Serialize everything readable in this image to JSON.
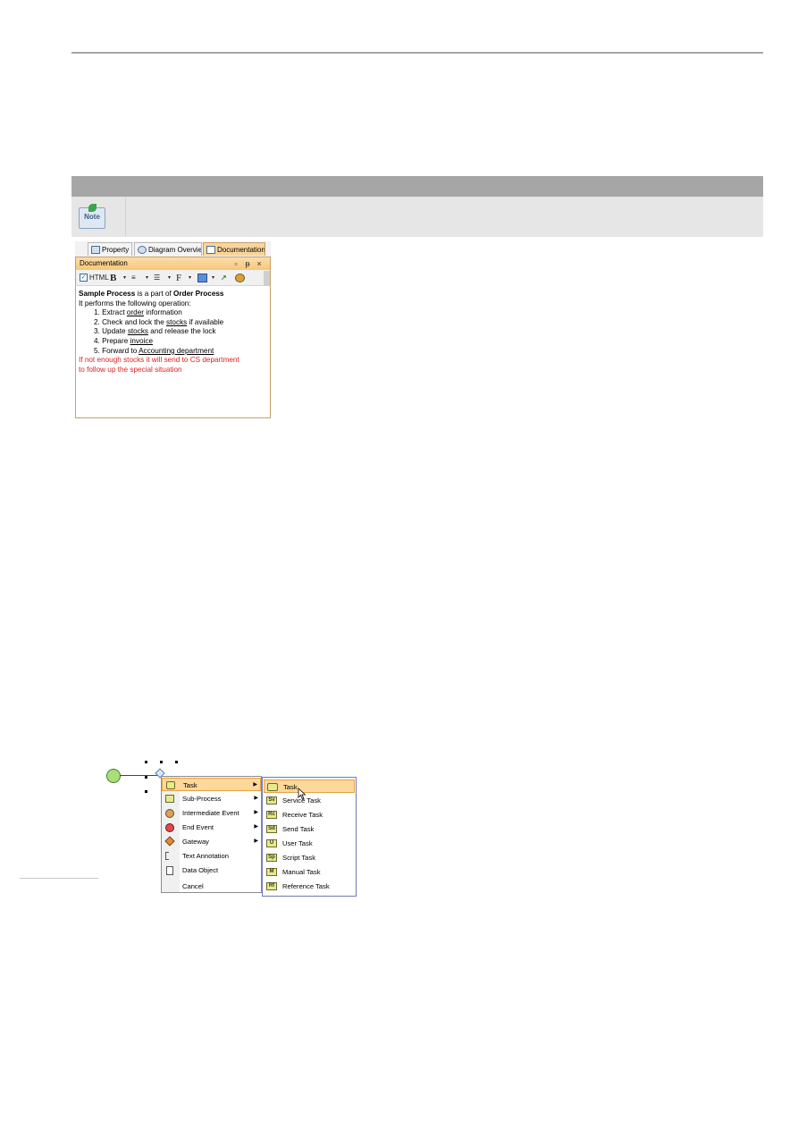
{
  "note": {
    "icon_label": "Note"
  },
  "panel": {
    "tabs": [
      "Property",
      "Diagram Overview",
      "Documentation"
    ],
    "title": "Documentation",
    "toolbar": {
      "html_label": "HTML",
      "bold_label": "B",
      "font_label": "F"
    },
    "content": {
      "line1": {
        "b1": "Sample Process",
        "mid": " is a part of ",
        "b2": "Order Process"
      },
      "line2": "It performs the following operation:",
      "steps": [
        {
          "num": "1.",
          "pre": "Extract ",
          "u": "order",
          "post": " information"
        },
        {
          "num": "2.",
          "pre": "Check and lock the ",
          "u": "stocks",
          "post": " if available"
        },
        {
          "num": "3.",
          "pre": "Update ",
          "u": "stocks",
          "post": " and release the lock"
        },
        {
          "num": "4.",
          "pre": "Prepare ",
          "u": "invoice",
          "post": ""
        },
        {
          "num": "5.",
          "pre": "Forward to ",
          "u": "Accounting department",
          "post": ""
        }
      ],
      "red1": "If not enough stocks it will send to CS department",
      "red2": "to follow up the special situation"
    }
  },
  "context_menu": {
    "items": [
      {
        "label": "Task",
        "arrow": "▶"
      },
      {
        "label": "Sub-Process",
        "arrow": "▶"
      },
      {
        "label": "Intermediate Event",
        "arrow": "▶"
      },
      {
        "label": "End Event",
        "arrow": "▶"
      },
      {
        "label": "Gateway",
        "arrow": "▶"
      },
      {
        "label": "Text Annotation"
      },
      {
        "label": "Data Object"
      },
      {
        "label": "Cancel"
      }
    ]
  },
  "submenu": {
    "items": [
      {
        "label": "Task",
        "icon": ""
      },
      {
        "label": "Service Task",
        "icon": "Sv"
      },
      {
        "label": "Receive Task",
        "icon": "Rc"
      },
      {
        "label": "Send Task",
        "icon": "Sd"
      },
      {
        "label": "User Task",
        "icon": "U"
      },
      {
        "label": "Script Task",
        "icon": "Sp"
      },
      {
        "label": "Manual Task",
        "icon": "M"
      },
      {
        "label": "Reference Task",
        "icon": "Rf"
      }
    ]
  },
  "colors": {
    "note_header": "#a6a6a6",
    "note_body": "#e6e6e6",
    "highlight": "#fcd89a",
    "red_text": "#e02020"
  }
}
